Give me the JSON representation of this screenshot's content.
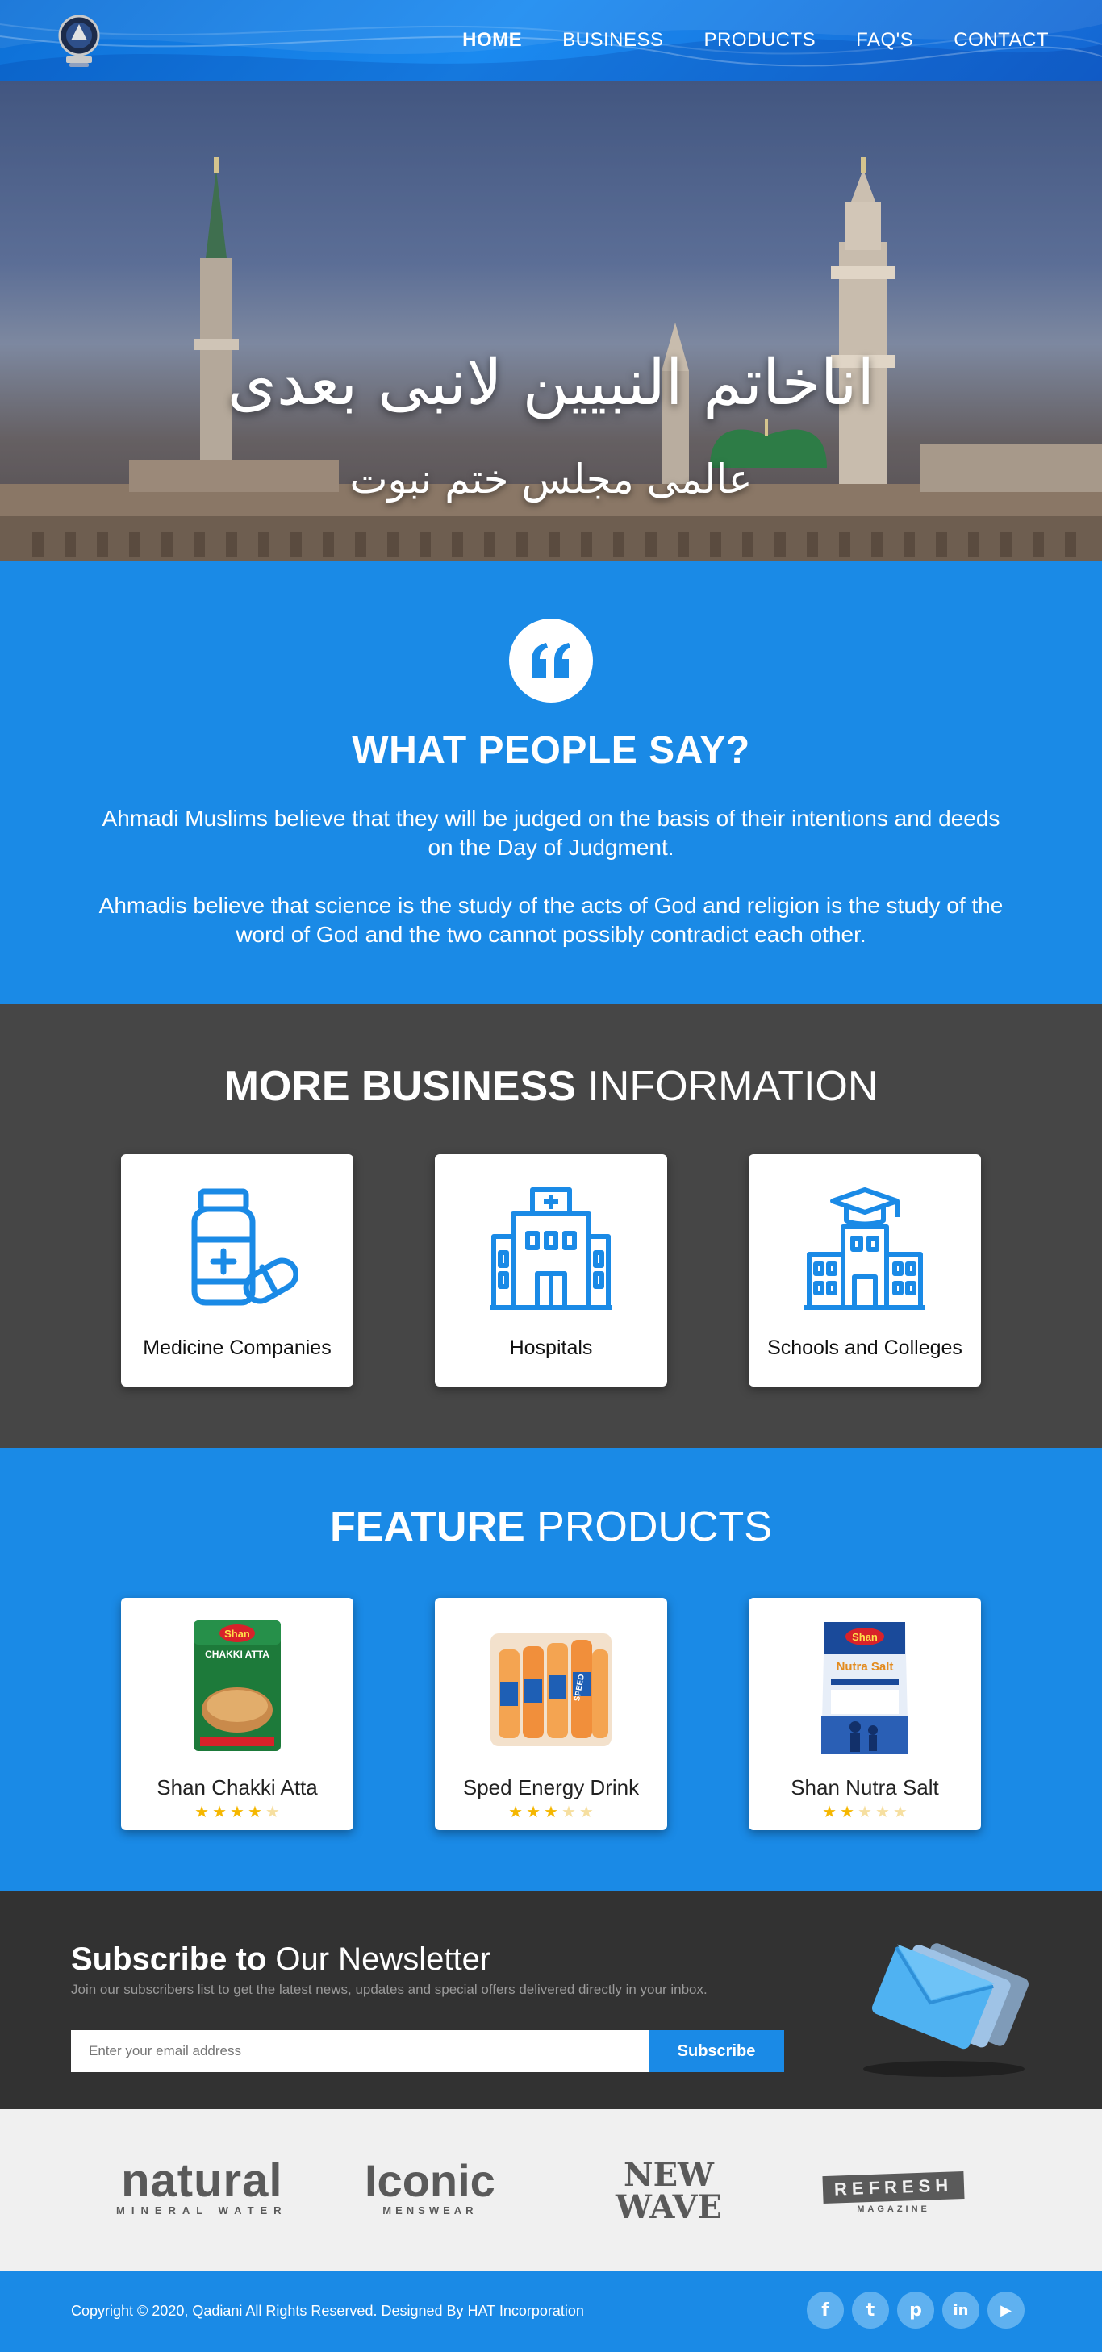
{
  "header": {
    "nav": [
      {
        "label": "HOME",
        "active": true
      },
      {
        "label": "BUSINESS",
        "active": false
      },
      {
        "label": "PRODUCTS",
        "active": false
      },
      {
        "label": "FAQ'S",
        "active": false
      },
      {
        "label": "CONTACT",
        "active": false
      }
    ]
  },
  "hero": {
    "title": "اناخاتم النبیین لانبی بعدی",
    "subtitle": "عالمی مجلس ختم نبوت"
  },
  "testimonial": {
    "icon": "quote-icon",
    "heading": "WHAT PEOPLE SAY?",
    "paragraphs": [
      "Ahmadi Muslims believe that they will be judged on the basis of their intentions and deeds on the Day of Judgment.",
      "Ahmadis believe that science is the study of the acts of God and religion is the study of the word of God and the two cannot possibly contradict each other."
    ]
  },
  "business": {
    "title_bold": "MORE BUSINESS",
    "title_light": "INFORMATION",
    "cards": [
      {
        "label": "Medicine Companies",
        "icon": "medicine-icon"
      },
      {
        "label": "Hospitals",
        "icon": "hospital-icon"
      },
      {
        "label": "Schools and Colleges",
        "icon": "school-icon"
      }
    ]
  },
  "products": {
    "title_bold": "FEATURE",
    "title_light": "PRODUCTS",
    "items": [
      {
        "name": "Shan Chakki Atta",
        "rating": 4,
        "pack_brand": "Shan",
        "pack_text": "CHAKKI ATTA"
      },
      {
        "name": "Sped Energy Drink",
        "rating": 3,
        "pack_text": "SPEED"
      },
      {
        "name": "Shan Nutra Salt",
        "rating": 2,
        "pack_brand": "Shan",
        "pack_text": "Nutra Salt"
      }
    ]
  },
  "newsletter": {
    "title_bold": "Subscribe to",
    "title_light": "Our Newsletter",
    "subtitle": "Join our subscribers list to get the latest news, updates and special offers delivered directly in your inbox.",
    "input_placeholder": "Enter your email address",
    "button_label": "Subscribe"
  },
  "brands": [
    {
      "main": "natural",
      "sub": "MINERAL WATER"
    },
    {
      "main": "Iconic",
      "sub": "MENSWEAR"
    },
    {
      "main": "NEW WAVE",
      "sub": ""
    },
    {
      "main": "REFRESH",
      "sub": "MAGAZINE"
    }
  ],
  "footer": {
    "copyright": "Copyright © 2020, Qadiani All Rights Reserved. Designed By HAT Incorporation",
    "socials": [
      {
        "icon": "facebook-icon",
        "glyph": "f"
      },
      {
        "icon": "twitter-icon",
        "glyph": "t"
      },
      {
        "icon": "pinterest-icon",
        "glyph": "p"
      },
      {
        "icon": "linkedin-icon",
        "glyph": "in"
      },
      {
        "icon": "youtube-icon",
        "glyph": "▶"
      }
    ]
  },
  "colors": {
    "primary_blue": "#1a8ae6",
    "dark_gray": "#464646",
    "newsletter_bg": "#323232",
    "brands_bg": "#f0f0f0",
    "star": "#f5b700"
  }
}
